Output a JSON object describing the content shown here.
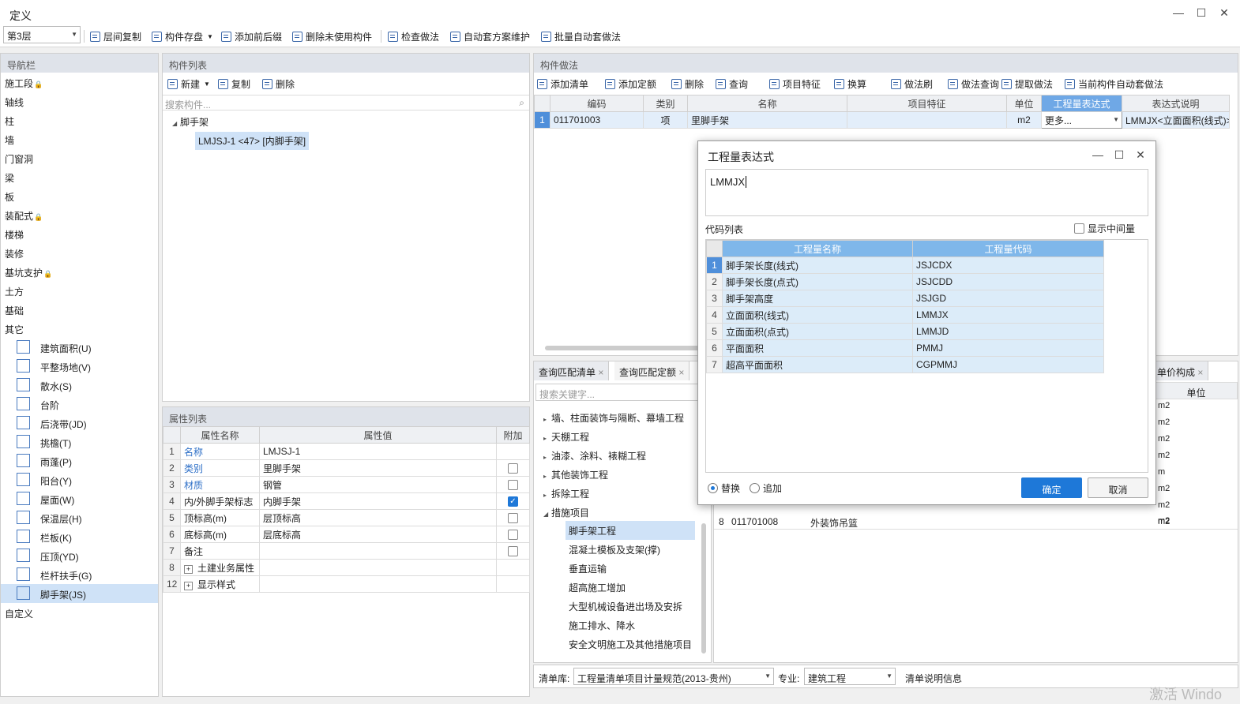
{
  "window": {
    "title": "定义",
    "minimize": "—",
    "maximize": "☐",
    "close": "✕"
  },
  "toolbar": {
    "floor": "第3层",
    "items": [
      "层间复制",
      "构件存盘",
      "添加前后缀",
      "删除未使用构件",
      "检查做法",
      "自动套方案维护",
      "批量自动套做法"
    ]
  },
  "nav": {
    "header": "导航栏",
    "items": [
      "施工段",
      "轴线",
      "柱",
      "墙",
      "门窗洞",
      "梁",
      "板",
      "装配式",
      "楼梯",
      "装修",
      "基坑支护",
      "土方",
      "基础",
      "其它"
    ],
    "sub": [
      "建筑面积(U)",
      "平整场地(V)",
      "散水(S)",
      "台阶",
      "后浇带(JD)",
      "挑檐(T)",
      "雨蓬(P)",
      "阳台(Y)",
      "屋面(W)",
      "保温层(H)",
      "栏板(K)",
      "压顶(YD)",
      "栏杆扶手(G)",
      "脚手架(JS)"
    ],
    "last": "自定义",
    "lock": "🔒"
  },
  "complist": {
    "header": "构件列表",
    "new": "新建",
    "copy": "复制",
    "del": "删除",
    "search_placeholder": "搜索构件...",
    "root": "脚手架",
    "item": "LMJSJ-1 <47> [内脚手架]"
  },
  "props": {
    "header": "属性列表",
    "cols": [
      "属性名称",
      "属性值",
      "附加"
    ],
    "rows": [
      [
        "1",
        "名称",
        "LMJSJ-1",
        ""
      ],
      [
        "2",
        "类别",
        "里脚手架",
        "off"
      ],
      [
        "3",
        "材质",
        "钢管",
        "off"
      ],
      [
        "4",
        "内/外脚手架标志",
        "内脚手架",
        "on"
      ],
      [
        "5",
        "顶标高(m)",
        "层顶标高",
        "off"
      ],
      [
        "6",
        "底标高(m)",
        "层底标高",
        "off"
      ],
      [
        "7",
        "备注",
        "",
        "off"
      ],
      [
        "8",
        "土建业务属性",
        "",
        ""
      ],
      [
        "12",
        "显示样式",
        "",
        ""
      ]
    ]
  },
  "method": {
    "header": "构件做法",
    "toolbar": [
      "添加清单",
      "添加定额",
      "删除",
      "查询",
      "项目特征",
      "换算",
      "做法刷",
      "做法查询",
      "提取做法",
      "当前构件自动套做法"
    ],
    "cols": [
      "编码",
      "类别",
      "名称",
      "项目特征",
      "单位",
      "工程量表达式",
      "表达式说明"
    ],
    "row": [
      "1",
      "011701003",
      "项",
      "里脚手架",
      "",
      "m2",
      "更多...",
      "LMMJX<立面面积(线式)>"
    ]
  },
  "bottom": {
    "tabs": [
      "查询匹配清单",
      "查询匹配定额"
    ],
    "tab_right": "单价构成",
    "search_placeholder": "搜索关键字...",
    "tree": [
      "墙、柱面装饰与隔断、幕墙工程",
      "天棚工程",
      "油漆、涂料、裱糊工程",
      "其他装饰工程",
      "拆除工程",
      "措施项目"
    ],
    "subtree": [
      "脚手架工程",
      "混凝土模板及支架(撑)",
      "垂直运输",
      "超高施工增加",
      "大型机械设备进出场及安拆",
      "施工排水、降水",
      "安全文明施工及其他措施项目"
    ],
    "unit_header": "单位",
    "units": [
      "m2",
      "m2",
      "m2",
      "m2",
      "m",
      "m2",
      "m2",
      "m2"
    ],
    "last_row": [
      "8",
      "011701008",
      "外装饰吊篮",
      "m2"
    ],
    "lib_label": "清单库:",
    "lib": "工程量清单项目计量规范(2013-贵州)",
    "spec_label": "专业:",
    "spec": "建筑工程",
    "info": "清单说明信息"
  },
  "dialog": {
    "title": "工程量表达式",
    "expr": "LMMJX",
    "code_list": "代码列表",
    "show_mid": "显示中间量",
    "cols": [
      "工程量名称",
      "工程量代码"
    ],
    "rows": [
      [
        "1",
        "脚手架长度(线式)",
        "JSJCDX"
      ],
      [
        "2",
        "脚手架长度(点式)",
        "JSJCDD"
      ],
      [
        "3",
        "脚手架高度",
        "JSJGD"
      ],
      [
        "4",
        "立面面积(线式)",
        "LMMJX"
      ],
      [
        "5",
        "立面面积(点式)",
        "LMMJD"
      ],
      [
        "6",
        "平面面积",
        "PMMJ"
      ],
      [
        "7",
        "超高平面面积",
        "CGPMMJ"
      ]
    ],
    "replace": "替换",
    "append": "追加",
    "ok": "确定",
    "cancel": "取消"
  },
  "watermark": "激活 Windo"
}
